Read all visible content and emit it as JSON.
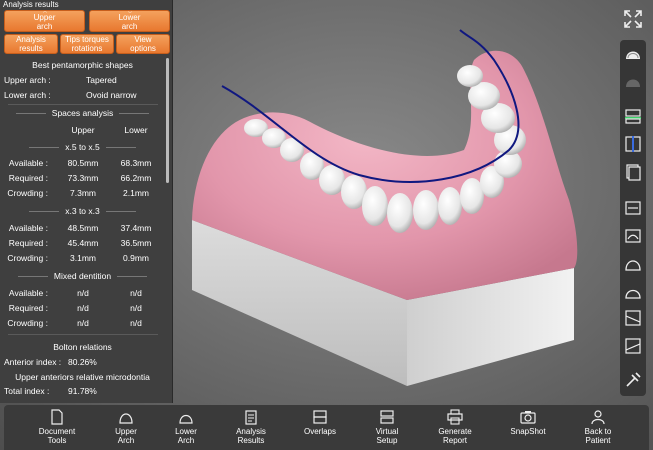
{
  "panel": {
    "title": "Analysis results",
    "arch_buttons": [
      {
        "label": "Upper\narch"
      },
      {
        "label": "Lower\narch"
      }
    ],
    "tab_buttons": [
      {
        "label": "Analysis\nresults"
      },
      {
        "label": "Tips torques\nrotations"
      },
      {
        "label": "View\noptions"
      }
    ],
    "pentamorphic": {
      "heading": "Best pentamorphic shapes",
      "rows": [
        {
          "label": "Upper arch :",
          "value": "Tapered"
        },
        {
          "label": "Lower arch :",
          "value": "Ovoid narrow"
        }
      ]
    },
    "spaces": {
      "heading": "Spaces analysis",
      "col_upper": "Upper",
      "col_lower": "Lower",
      "groups": [
        {
          "title": "x.5 to x.5",
          "rows": [
            {
              "label": "Available :",
              "upper": "80.5mm",
              "lower": "68.3mm"
            },
            {
              "label": "Required :",
              "upper": "73.3mm",
              "lower": "66.2mm"
            },
            {
              "label": "Crowding :",
              "upper": "7.3mm",
              "lower": "2.1mm"
            }
          ]
        },
        {
          "title": "x.3 to x.3",
          "rows": [
            {
              "label": "Available :",
              "upper": "48.5mm",
              "lower": "37.4mm"
            },
            {
              "label": "Required :",
              "upper": "45.4mm",
              "lower": "36.5mm"
            },
            {
              "label": "Crowding :",
              "upper": "3.1mm",
              "lower": "0.9mm"
            }
          ]
        },
        {
          "title": "Mixed dentition",
          "rows": [
            {
              "label": "Available :",
              "upper": "n/d",
              "lower": "n/d"
            },
            {
              "label": "Required :",
              "upper": "n/d",
              "lower": "n/d"
            },
            {
              "label": "Crowding :",
              "upper": "n/d",
              "lower": "n/d"
            }
          ]
        }
      ]
    },
    "bolton": {
      "heading": "Bolton relations",
      "anterior_label": "Anterior index :",
      "anterior_value": "80.26%",
      "microdontia": "Upper anteriors relative microdontia",
      "total_label": "Total index :",
      "total_value": "91.78%"
    }
  },
  "right_toolbar": {
    "icons": [
      "expand-icon",
      "upper-arch-icon",
      "upper-arch-dim-icon",
      "occlusion-plane-icon",
      "midline-icon",
      "layers-icon",
      "upper-jaw-icon",
      "lower-jaw-icon",
      "upper-outline-icon",
      "lower-outline-icon",
      "upper-section-icon",
      "lower-section-icon",
      "tools-icon"
    ]
  },
  "bottom_bar": {
    "items": [
      {
        "label": "Document\nTools",
        "icon": "document-icon"
      },
      {
        "label": "Upper\nArch",
        "icon": "upper-arch-icon"
      },
      {
        "label": "Lower\nArch",
        "icon": "lower-arch-icon"
      },
      {
        "label": "Analysis\nResults",
        "icon": "clipboard-icon"
      },
      {
        "label": "Overlaps",
        "icon": "overlaps-icon"
      },
      {
        "label": "Virtual\nSetup",
        "icon": "virtual-setup-icon"
      },
      {
        "label": "Generate\nReport",
        "icon": "printer-icon"
      },
      {
        "label": "SnapShot",
        "icon": "camera-icon"
      },
      {
        "label": "Back to\nPatient",
        "icon": "patient-icon"
      }
    ]
  },
  "colors": {
    "accent": "#ee8a3f",
    "panel_bg": "#3f3f3f",
    "gum": "#e39aae",
    "arch_curve": "#101880"
  }
}
